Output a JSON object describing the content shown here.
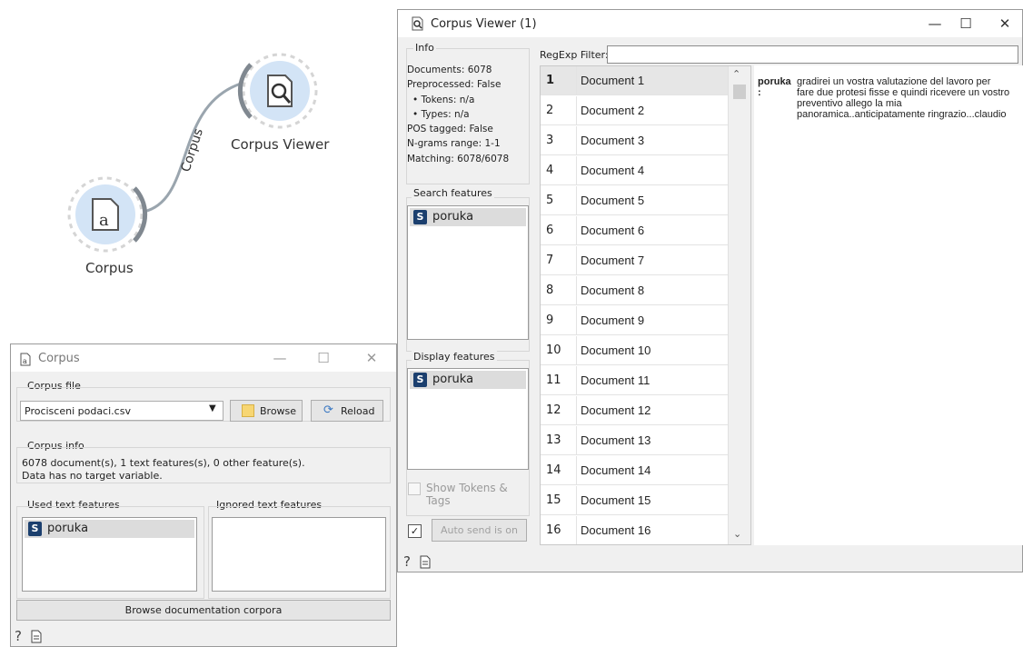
{
  "canvas": {
    "corpus_label": "Corpus",
    "viewer_label": "Corpus Viewer",
    "link_label": "Corpus"
  },
  "viewer": {
    "title": "Corpus Viewer (1)",
    "info": {
      "heading": "Info",
      "lines": [
        "Documents: 6078",
        "Preprocessed: False",
        "• Tokens: n/a",
        "• Types: n/a",
        "POS tagged: False",
        "N-grams range: 1-1",
        "Matching: 6078/6078"
      ]
    },
    "search_features_label": "Search features",
    "search_features": [
      "poruka"
    ],
    "display_features_label": "Display features",
    "display_features": [
      "poruka"
    ],
    "show_tokens_label": "Show Tokens & Tags",
    "auto_send_label": "Auto send is on",
    "filter_label": "RegExp Filter:",
    "filter_value": "",
    "documents": [
      {
        "n": "1",
        "name": "Document 1"
      },
      {
        "n": "2",
        "name": "Document 2"
      },
      {
        "n": "3",
        "name": "Document 3"
      },
      {
        "n": "4",
        "name": "Document 4"
      },
      {
        "n": "5",
        "name": "Document 5"
      },
      {
        "n": "6",
        "name": "Document 6"
      },
      {
        "n": "7",
        "name": "Document 7"
      },
      {
        "n": "8",
        "name": "Document 8"
      },
      {
        "n": "9",
        "name": "Document 9"
      },
      {
        "n": "10",
        "name": "Document 10"
      },
      {
        "n": "11",
        "name": "Document 11"
      },
      {
        "n": "12",
        "name": "Document 12"
      },
      {
        "n": "13",
        "name": "Document 13"
      },
      {
        "n": "14",
        "name": "Document 14"
      },
      {
        "n": "15",
        "name": "Document 15"
      },
      {
        "n": "16",
        "name": "Document 16"
      }
    ],
    "selected_row": 0,
    "detail_key": "poruka\n:",
    "detail_text": "gradirei un vostra valutazione del lavoro per fare due protesi fisse e quindi ricevere un vostro preventivo allego la mia panoramica..anticipatamente ringrazio...claudio"
  },
  "corpus_win": {
    "title": "Corpus",
    "corpus_file_label": "Corpus file",
    "file_value": "Procisceni podaci.csv",
    "browse_label": "Browse",
    "reload_label": "Reload",
    "corpus_info_label": "Corpus info",
    "info_line1": "6078 document(s), 1 text features(s), 0 other feature(s).",
    "info_line2": "Data has no target variable.",
    "used_label": "Used text features",
    "ignored_label": "Ignored text features",
    "used_features": [
      "poruka"
    ],
    "doc_button": "Browse documentation corpora"
  },
  "colors": {
    "node_fill": "#d3e4f6",
    "badge": "#1b3f6e",
    "link": "#9aa5ae"
  }
}
